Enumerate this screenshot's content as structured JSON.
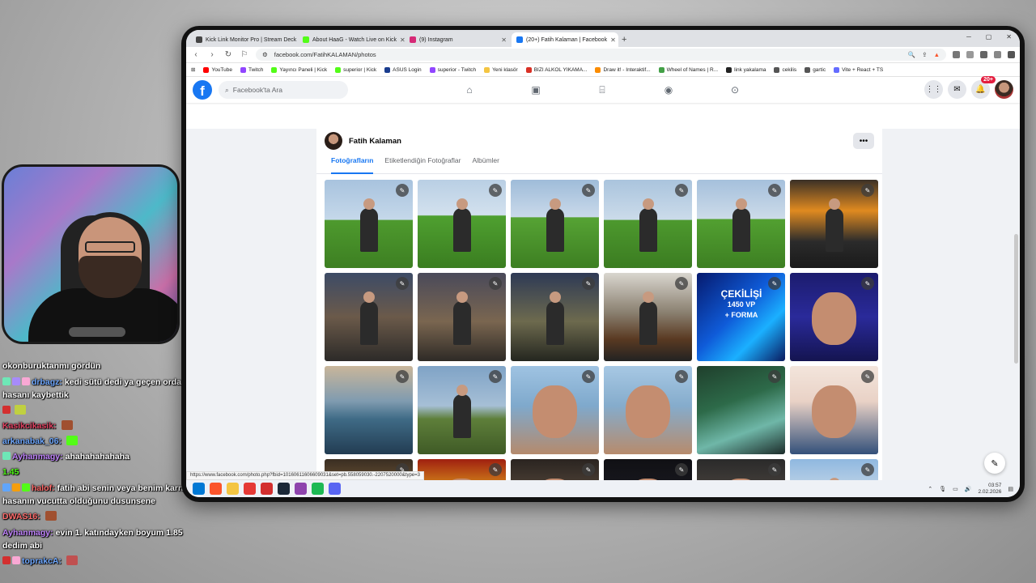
{
  "browser": {
    "tabs": [
      {
        "label": "Kick Link Monitor Pro | Stream Deck",
        "color": "#444444",
        "active": false
      },
      {
        "label": "About HaaG - Watch Live on Kick",
        "color": "#53fc18",
        "active": false
      },
      {
        "label": "(9) Instagram",
        "color": "#d62976",
        "active": false
      },
      {
        "label": "(20+) Fatih Kalaman | Facebook",
        "color": "#1877f2",
        "active": true
      }
    ],
    "url": "facebook.com/FatihKALAMAN/photos",
    "bookmarks": [
      {
        "label": "YouTube",
        "color": "#ff0000"
      },
      {
        "label": "Twitch",
        "color": "#9146ff"
      },
      {
        "label": "Yayıncı Paneli | Kick",
        "color": "#53fc18"
      },
      {
        "label": "superior | Kick",
        "color": "#53fc18"
      },
      {
        "label": "ASUS Login",
        "color": "#1a3c8e"
      },
      {
        "label": "superior - Twitch",
        "color": "#9146ff"
      },
      {
        "label": "Yeni klasör",
        "color": "#f4c542"
      },
      {
        "label": "BIZI ALKOL YIKAMA...",
        "color": "#d93025"
      },
      {
        "label": "Draw it! - Interaktif...",
        "color": "#fb8c00"
      },
      {
        "label": "Wheel of Names | R...",
        "color": "#43a047"
      },
      {
        "label": "link yakalama",
        "color": "#222222"
      },
      {
        "label": "cekilis",
        "color": "#555555"
      },
      {
        "label": "gartic",
        "color": "#555555"
      },
      {
        "label": "Vite + React + TS",
        "color": "#646cff"
      }
    ],
    "status_url": "https://www.facebook.com/photo.php?fbid=10160611606609031&set=pb.558059030.-2207520000&type=3"
  },
  "facebook": {
    "search_placeholder": "Facebook'ta Ara",
    "notification_count": "20+",
    "profile_name": "Fatih Kalaman",
    "photo_tabs": [
      "Fotoğrafların",
      "Etiketlendiğin Fotoğraflar",
      "Albümler"
    ],
    "giveaway_text": "ÇEKİLİŞİ",
    "giveaway_sub": "1450 VP",
    "giveaway_forma": "+ FORMA",
    "photos": [
      {
        "kind": "park",
        "bg": "linear-gradient(180deg,#a8c3de 0%,#c5d8ea 45%,#4e9a2e 46%,#3d7f22 100%)"
      },
      {
        "kind": "park",
        "bg": "linear-gradient(180deg,#b9cfe4 0%,#d3e1ee 40%,#4fa030 41%,#3a7d20 100%)"
      },
      {
        "kind": "park",
        "bg": "linear-gradient(180deg,#9fbcd9 0%,#c9d9ea 42%,#56a334 43%,#3d7f22 100%)"
      },
      {
        "kind": "park",
        "bg": "linear-gradient(180deg,#aac4dd 0%,#cbdbea 45%,#4d992e 46%,#3b7c21 100%)"
      },
      {
        "kind": "park",
        "bg": "linear-gradient(180deg,#a5c0dc 0%,#ccdbe9 44%,#52a031 45%,#3d7f22 100%)"
      },
      {
        "kind": "room",
        "bg": "linear-gradient(180deg,#3a3026 0%,#e08a20 35%,#2b2b2b 70%,#1a1a1a 100%)"
      },
      {
        "kind": "night",
        "bg": "linear-gradient(180deg,#3d4b66 0%,#6b5a4a 50%,#2c2a28 100%)"
      },
      {
        "kind": "night",
        "bg": "linear-gradient(180deg,#4a4a5a 0%,#7a6650 55%,#2e2a26 100%)"
      },
      {
        "kind": "night",
        "bg": "linear-gradient(180deg,#2e3a55 0%,#6d6a4e 55%,#24261f 100%)"
      },
      {
        "kind": "room",
        "bg": "linear-gradient(180deg,#d9d6cf 0%,#8a8070 45%,#5a3a22 75%,#222 100%)"
      },
      {
        "kind": "promo",
        "bg": "linear-gradient(135deg,#061a6e 0%,#0f5bd8 45%,#1bb0ff 70%,#0a1a5e 100%)"
      },
      {
        "kind": "portrait",
        "bg": "linear-gradient(180deg,#1c1c6e 0%,#2a2a9a 50%,#141450 100%)"
      },
      {
        "kind": "sea",
        "bg": "linear-gradient(180deg,#c9b69a 0%,#7f9bb0 40%,#3f6b86 60%,#223c52 100%)"
      },
      {
        "kind": "field",
        "bg": "linear-gradient(180deg,#7fa3c6 0%,#a6bfd6 45%,#5e7f3a 60%,#3f5a26 100%)"
      },
      {
        "kind": "selfie",
        "bg": "linear-gradient(180deg,#9fc3e2 0%,#7fa9cc 45%,#b58a6c 100%)"
      },
      {
        "kind": "selfie",
        "bg": "linear-gradient(180deg,#a7c8e4 0%,#85accc 45%,#b78b6c 100%)"
      },
      {
        "kind": "game",
        "bg": "linear-gradient(160deg,#1f3f2c 0%,#2d6a49 40%,#6fb7a8 70%,#1c2c2a 100%)"
      },
      {
        "kind": "selfie",
        "bg": "linear-gradient(180deg,#f3e5dc 0%,#e9d2c6 40%,#33507a 100%)"
      },
      {
        "kind": "dark",
        "bg": "linear-gradient(180deg,#3a2e22 0%,#8a6a40 50%,#2a2018 100%)"
      },
      {
        "kind": "dark",
        "bg": "linear-gradient(180deg,#a02010 0%,#f0c020 50%,#5a3a10 100%)"
      },
      {
        "kind": "dark",
        "bg": "linear-gradient(180deg,#2a2420 0%,#6a5848 60%,#241e1a 100%)"
      },
      {
        "kind": "dark",
        "bg": "linear-gradient(180deg,#101014 0%,#1e1e26 60%,#2a2a30 100%)"
      },
      {
        "kind": "dark",
        "bg": "linear-gradient(180deg,#2a2a2a 0%,#5a5048 60%,#1e1a18 100%)"
      },
      {
        "kind": "team",
        "bg": "linear-gradient(180deg,#8fb8e0 0%,#c8d8e8 40%,#b04040 70%,#e8e8e8 100%)"
      }
    ]
  },
  "taskbar": {
    "time": "03:57",
    "date": "2.02.2026",
    "apps": [
      {
        "name": "windows-start-icon",
        "color": "#0078d4"
      },
      {
        "name": "brave-icon",
        "color": "#fb542b"
      },
      {
        "name": "folder-icon",
        "color": "#f4c542"
      },
      {
        "name": "pin-icon",
        "color": "#e53935"
      },
      {
        "name": "obs-icon",
        "color": "#d32f2f"
      },
      {
        "name": "steam-icon",
        "color": "#1b2838"
      },
      {
        "name": "app-icon",
        "color": "#8e44ad"
      },
      {
        "name": "spotify-icon",
        "color": "#1db954"
      },
      {
        "name": "discord-icon",
        "color": "#5865f2"
      }
    ]
  },
  "chat": [
    {
      "user": "",
      "user_color": "#ffffff",
      "message": "okonburuktanmı gördün",
      "badges": []
    },
    {
      "user": "drbagz:",
      "user_color": "#6fa8ff",
      "message": "kedi sütü dedi ya geçen orda hasanı kaybettik",
      "badges": [
        "#6ee7b7",
        "#a78bfa",
        "#f9a8d4"
      ]
    },
    {
      "user": "",
      "user_color": "#53fc18",
      "message": "",
      "badges": [
        "#d32f2f"
      ],
      "emote": "#c0d040"
    },
    {
      "user": "Kasikcikasik:",
      "user_color": "#e04060",
      "message": "",
      "badges": [],
      "emote": "#a05030"
    },
    {
      "user": "arkanabak_06:",
      "user_color": "#6fa8ff",
      "message": "",
      "badges": [],
      "emote": "#53fc18"
    },
    {
      "user": "Ayhanmagy:",
      "user_color": "#c084fc",
      "message": "ahahahahahaha",
      "badges": [
        "#6ee7b7"
      ]
    },
    {
      "user": "",
      "user_color": "#53fc18",
      "message": "1.45",
      "badges": []
    },
    {
      "user": "halof:",
      "user_color": "#ff6b6b",
      "message": "fatih abi senin veya benim karnımda hasanın vucutta olduğunu dusunsene",
      "badges": [
        "#60a5fa",
        "#f59e0b",
        "#53fc18"
      ]
    },
    {
      "user": "DWAS16:",
      "user_color": "#ff6b6b",
      "message": "",
      "badges": [],
      "emote": "#a05030"
    },
    {
      "user": "Ayhanmagy:",
      "user_color": "#c084fc",
      "message": "evin 1. katındayken boyum 1.85 dedim abi",
      "badges": []
    },
    {
      "user": "toprakcA:",
      "user_color": "#6fa8ff",
      "message": "",
      "badges": [
        "#d32f2f",
        "#f9a8d4"
      ],
      "emote": "#c05050"
    }
  ]
}
